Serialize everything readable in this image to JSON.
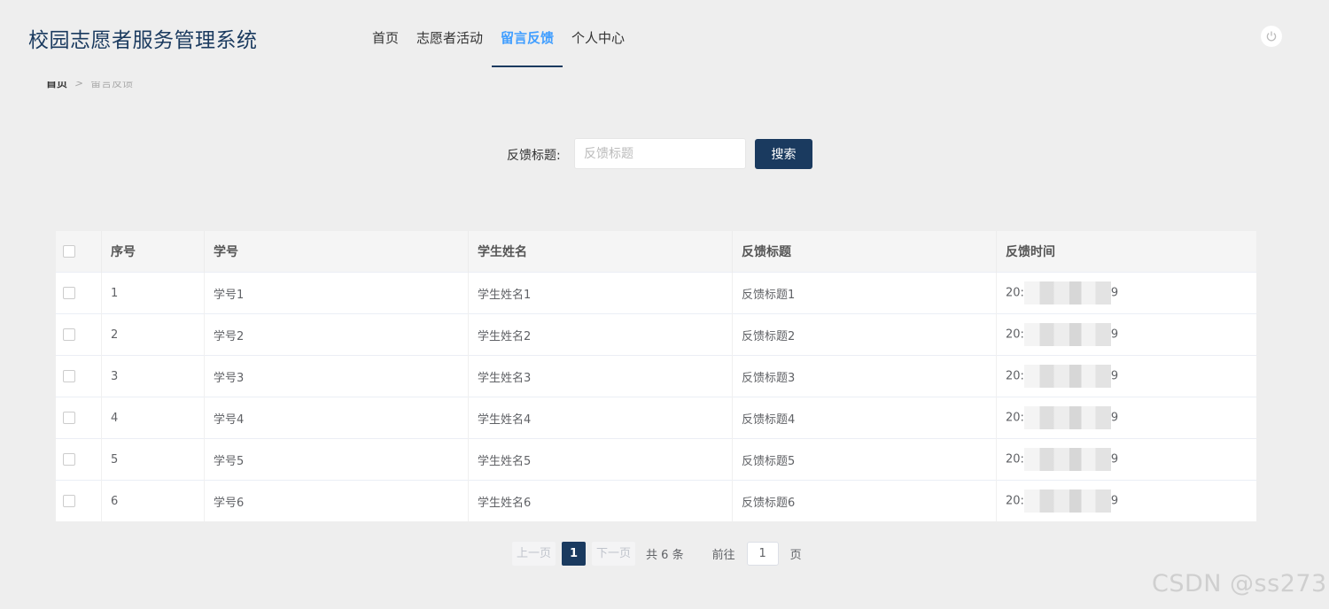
{
  "header": {
    "brand": "校园志愿者服务管理系统",
    "nav": [
      {
        "label": "首页",
        "active": false
      },
      {
        "label": "志愿者活动",
        "active": false
      },
      {
        "label": "留言反馈",
        "active": true
      },
      {
        "label": "个人中心",
        "active": false
      }
    ],
    "power_icon": "power-icon"
  },
  "breadcrumb": {
    "home": "首页",
    "separator": ">",
    "current": "留言反馈"
  },
  "search": {
    "label": "反馈标题:",
    "placeholder": "反馈标题",
    "value": "",
    "button": "搜索"
  },
  "table": {
    "columns": [
      "序号",
      "学号",
      "学生姓名",
      "反馈标题",
      "反馈时间"
    ],
    "rows": [
      {
        "index": "1",
        "student_id": "学号1",
        "name": "学生姓名1",
        "title": "反馈标题1",
        "time_prefix": "20:",
        "time_suffix": "9"
      },
      {
        "index": "2",
        "student_id": "学号2",
        "name": "学生姓名2",
        "title": "反馈标题2",
        "time_prefix": "20:",
        "time_suffix": "9"
      },
      {
        "index": "3",
        "student_id": "学号3",
        "name": "学生姓名3",
        "title": "反馈标题3",
        "time_prefix": "20:",
        "time_suffix": "9"
      },
      {
        "index": "4",
        "student_id": "学号4",
        "name": "学生姓名4",
        "title": "反馈标题4",
        "time_prefix": "20:",
        "time_suffix": "9"
      },
      {
        "index": "5",
        "student_id": "学号5",
        "name": "学生姓名5",
        "title": "反馈标题5",
        "time_prefix": "20:",
        "time_suffix": "9"
      },
      {
        "index": "6",
        "student_id": "学号6",
        "name": "学生姓名6",
        "title": "反馈标题6",
        "time_prefix": "20:",
        "time_suffix": "9"
      }
    ]
  },
  "pagination": {
    "prev": "上一页",
    "current": "1",
    "next": "下一页",
    "total": "共 6 条",
    "goto": "前往",
    "goto_value": "1",
    "page_unit": "页"
  },
  "watermark": "CSDN @ss273",
  "colors": {
    "brand": "#1a3a5f",
    "accent": "#409eff",
    "background": "#eeeeee"
  }
}
